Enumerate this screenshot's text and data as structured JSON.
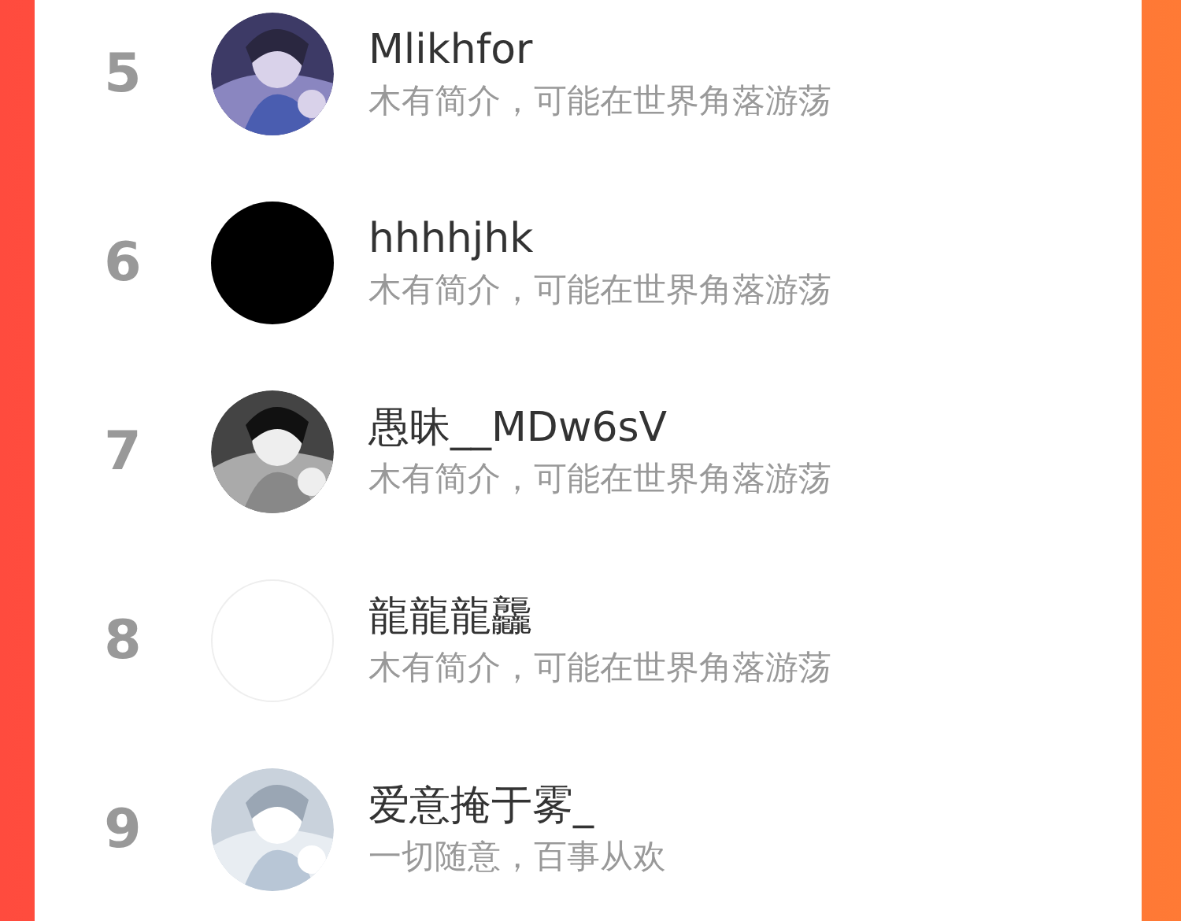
{
  "ranking": [
    {
      "rank": "5",
      "name": "Mlikhfor",
      "bio": "木有简介，可能在世界角落游荡"
    },
    {
      "rank": "6",
      "avatar": {
        "kind": "solid"
      },
      "name": "hhhhjhk",
      "bio": "木有简介，可能在世界角落游荡"
    },
    {
      "rank": "7",
      "name": "愚昧__MDw6sV",
      "bio": "木有简介，可能在世界角落游荡"
    },
    {
      "rank": "8",
      "avatar": {
        "kind": "empty"
      },
      "name": "龍龍龍龘",
      "bio": "木有简介，可能在世界角落游荡"
    },
    {
      "rank": "9",
      "name": "爱意掩于雾_",
      "bio": "一切随意，百事从欢"
    }
  ]
}
